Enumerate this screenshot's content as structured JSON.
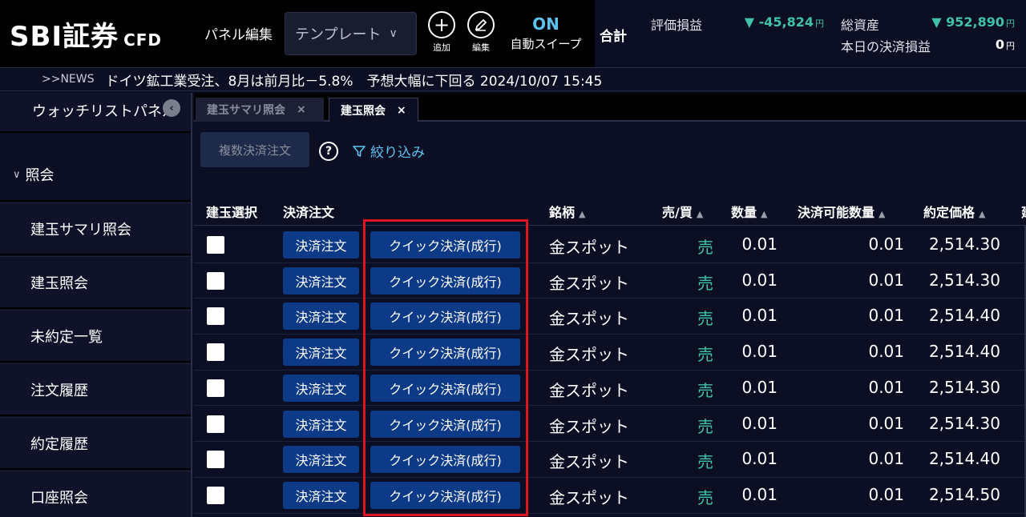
{
  "header": {
    "logo_text": "SBI証券",
    "logo_sub": "CFD",
    "panel_edit_label": "パネル編集",
    "template_select": "テンプレート",
    "add_label": "追加",
    "edit_label": "編集",
    "sweep_status": "ON",
    "sweep_label": "自動スイープ"
  },
  "summary": {
    "title": "合計",
    "eval_pl_label": "評価損益",
    "eval_pl_value": "▼ -45,824",
    "total_assets_label": "総資産",
    "total_assets_value": "▼ 952,890",
    "today_settle_label": "本日の決済損益",
    "today_settle_value": "0",
    "yen": "円"
  },
  "news": {
    "tag": ">>NEWS",
    "text": "ドイツ鉱工業受注、8月は前月比－5.8%　予想大幅に下回る  2024/10/07 15:45"
  },
  "sidebar": {
    "partial_item": "ウォッチリストパネル",
    "section": "照会",
    "items": [
      "建玉サマリ照会",
      "建玉照会",
      "未約定一覧",
      "注文履歴",
      "約定履歴",
      "口座照会"
    ]
  },
  "tabs": [
    {
      "label": "建玉サマリ照会",
      "close": "×"
    },
    {
      "label": "建玉照会",
      "close": "×"
    }
  ],
  "toolbar": {
    "multi_settle": "複数決済注文",
    "help": "?",
    "filter": "絞り込み"
  },
  "table": {
    "headers": {
      "select": "建玉選択",
      "order": "決済注文",
      "symbol": "銘柄",
      "side": "売/買",
      "qty": "数量",
      "settleable": "決済可能数量",
      "price": "約定価格",
      "extra": "建"
    },
    "order_btn": "決済注文",
    "quick_btn": "クイック決済(成行)",
    "rows": [
      {
        "symbol": "金スポット",
        "side": "売",
        "qty": "0.01",
        "settleable": "0.01",
        "price": "2,514.30"
      },
      {
        "symbol": "金スポット",
        "side": "売",
        "qty": "0.01",
        "settleable": "0.01",
        "price": "2,514.30"
      },
      {
        "symbol": "金スポット",
        "side": "売",
        "qty": "0.01",
        "settleable": "0.01",
        "price": "2,514.40"
      },
      {
        "symbol": "金スポット",
        "side": "売",
        "qty": "0.01",
        "settleable": "0.01",
        "price": "2,514.40"
      },
      {
        "symbol": "金スポット",
        "side": "売",
        "qty": "0.01",
        "settleable": "0.01",
        "price": "2,514.30"
      },
      {
        "symbol": "金スポット",
        "side": "売",
        "qty": "0.01",
        "settleable": "0.01",
        "price": "2,514.30"
      },
      {
        "symbol": "金スポット",
        "side": "売",
        "qty": "0.01",
        "settleable": "0.01",
        "price": "2,514.40"
      },
      {
        "symbol": "金スポット",
        "side": "売",
        "qty": "0.01",
        "settleable": "0.01",
        "price": "2,514.50"
      }
    ]
  },
  "colors": {
    "accent_blue": "#5ec2f0",
    "button_blue": "#0d3a86",
    "sell_green": "#3fc2a8",
    "highlight_red": "#e0141e"
  }
}
